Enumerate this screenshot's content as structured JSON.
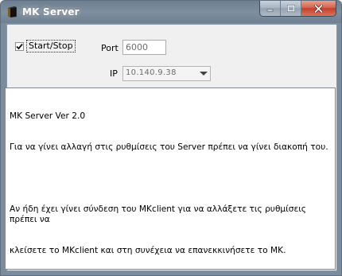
{
  "window": {
    "title": "MK Server",
    "icon": "book-icon",
    "controls": [
      "minimize-icon",
      "maximize-icon",
      "close-icon"
    ]
  },
  "controls": {
    "start_stop_label": "Start/Stop",
    "start_stop_checked": true,
    "port_label": "Port",
    "port_value": "6000",
    "ip_label": "IP",
    "ip_value": "10.140.9.38"
  },
  "log": {
    "lines": [
      "MK Server Ver 2.0",
      "Για να γίνει αλλαγή στις ρυθμίσεις του Server πρέπει να γίνει διακοπή του.",
      "",
      "Αν ήδη έχει γίνει σύνδεση του MKclient για να αλλάξετε τις ρυθμίσεις πρέπει να",
      "κλείσετε το MKclient και στη συνέχεια να επανεκκινήσετε το MK."
    ]
  }
}
